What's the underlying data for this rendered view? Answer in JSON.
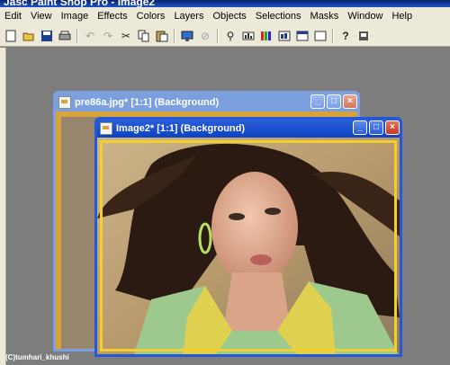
{
  "app": {
    "title": "Jasc Paint Shop Pro - Image2"
  },
  "menu": {
    "items": [
      "Edit",
      "View",
      "Image",
      "Effects",
      "Colors",
      "Layers",
      "Objects",
      "Selections",
      "Masks",
      "Window",
      "Help"
    ]
  },
  "toolbar": {
    "icons": [
      "new-icon",
      "open-icon",
      "save-icon",
      "print-icon",
      "undo-icon",
      "redo-icon",
      "cut-icon",
      "copy-icon",
      "paste-icon",
      "browse-icon",
      "zoom-icon",
      "histogram-icon",
      "layer-palette-icon",
      "overview-icon",
      "help-icon",
      "print-preview-icon"
    ]
  },
  "windows": [
    {
      "title": "pre86a.jpg* [1:1] (Background)",
      "controls": [
        "_",
        "□",
        "×"
      ]
    },
    {
      "title": "Image2* [1:1] (Background)",
      "controls": [
        "_",
        "□",
        "×"
      ]
    }
  ],
  "watermark": "(C)tumhari_khushi",
  "colors": {
    "active_titlebar": "#0a3fc2",
    "inactive_titlebar": "#7c9fe0",
    "close_button": "#c13a1e",
    "workspace": "#7d7d7d",
    "menu_bg": "#ece9d8"
  }
}
